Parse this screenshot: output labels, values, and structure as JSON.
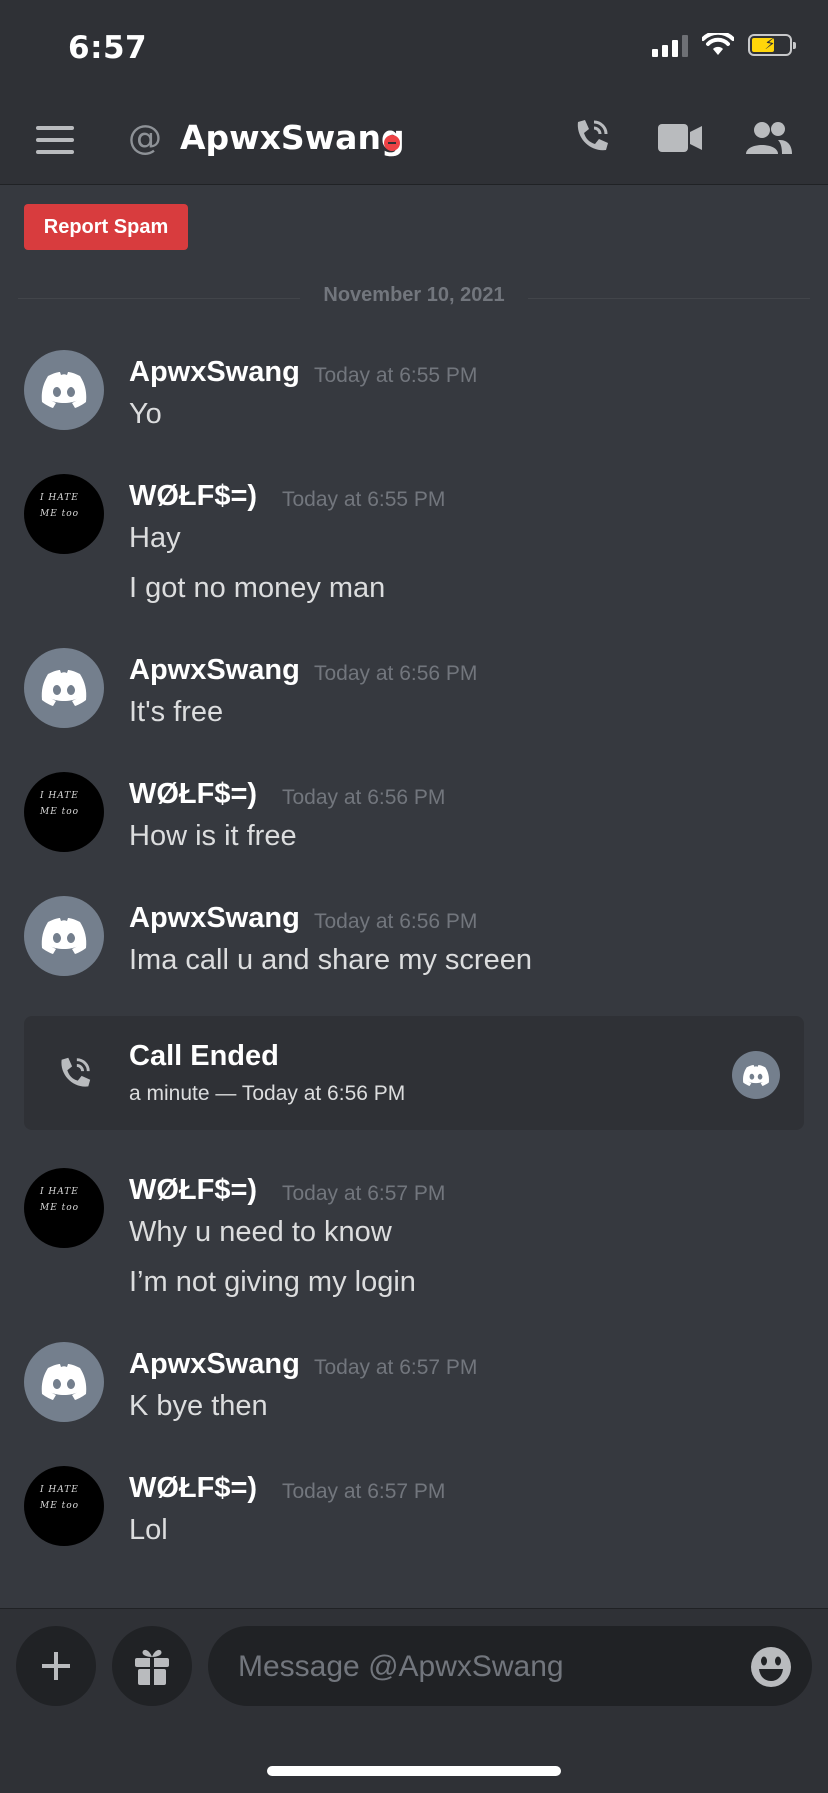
{
  "status_bar": {
    "time": "6:57"
  },
  "header": {
    "at_symbol": "@",
    "title": "ApwxSwang",
    "status": "do-not-disturb"
  },
  "report_spam": "Report Spam",
  "date_divider": "November 10, 2021",
  "messages": [
    {
      "author": "ApwxSwang",
      "timestamp": "Today at 6:55 PM",
      "avatar": "discord-logo-icon",
      "lines": [
        "Yo"
      ]
    },
    {
      "author": "WØŁF$=)",
      "timestamp": "Today at 6:55 PM",
      "avatar": "i-hate-me-too-avatar",
      "avatar_text": [
        "I HATE",
        "ME too"
      ],
      "lines": [
        "Hay",
        "I got no money man"
      ]
    },
    {
      "author": "ApwxSwang",
      "timestamp": "Today at 6:56 PM",
      "avatar": "discord-logo-icon",
      "lines": [
        "It's free"
      ]
    },
    {
      "author": "WØŁF$=)",
      "timestamp": "Today at 6:56 PM",
      "avatar": "i-hate-me-too-avatar",
      "avatar_text": [
        "I HATE",
        "ME too"
      ],
      "lines": [
        "How is it free"
      ]
    },
    {
      "author": "ApwxSwang",
      "timestamp": "Today at 6:56 PM",
      "avatar": "discord-logo-icon",
      "lines": [
        "Ima call u and share my screen"
      ]
    },
    {
      "author": "WØŁF$=)",
      "timestamp": "Today at 6:57 PM",
      "avatar": "i-hate-me-too-avatar",
      "avatar_text": [
        "I HATE",
        "ME too"
      ],
      "lines": [
        "Why u need to know",
        "I’m not giving my login"
      ]
    },
    {
      "author": "ApwxSwang",
      "timestamp": "Today at 6:57 PM",
      "avatar": "discord-logo-icon",
      "lines": [
        "K bye then"
      ]
    },
    {
      "author": "WØŁF$=)",
      "timestamp": "Today at 6:57 PM",
      "avatar": "i-hate-me-too-avatar",
      "avatar_text": [
        "I HATE",
        "ME too"
      ],
      "lines": [
        "Lol"
      ]
    }
  ],
  "call": {
    "title": "Call Ended",
    "subtitle": "a minute — Today at 6:56 PM"
  },
  "composer": {
    "placeholder": "Message @ApwxSwang"
  },
  "colors": {
    "background": "#36393f",
    "header": "#2f3136",
    "accent_red": "#d83c3e",
    "blurple_gray": "#747f8d"
  }
}
